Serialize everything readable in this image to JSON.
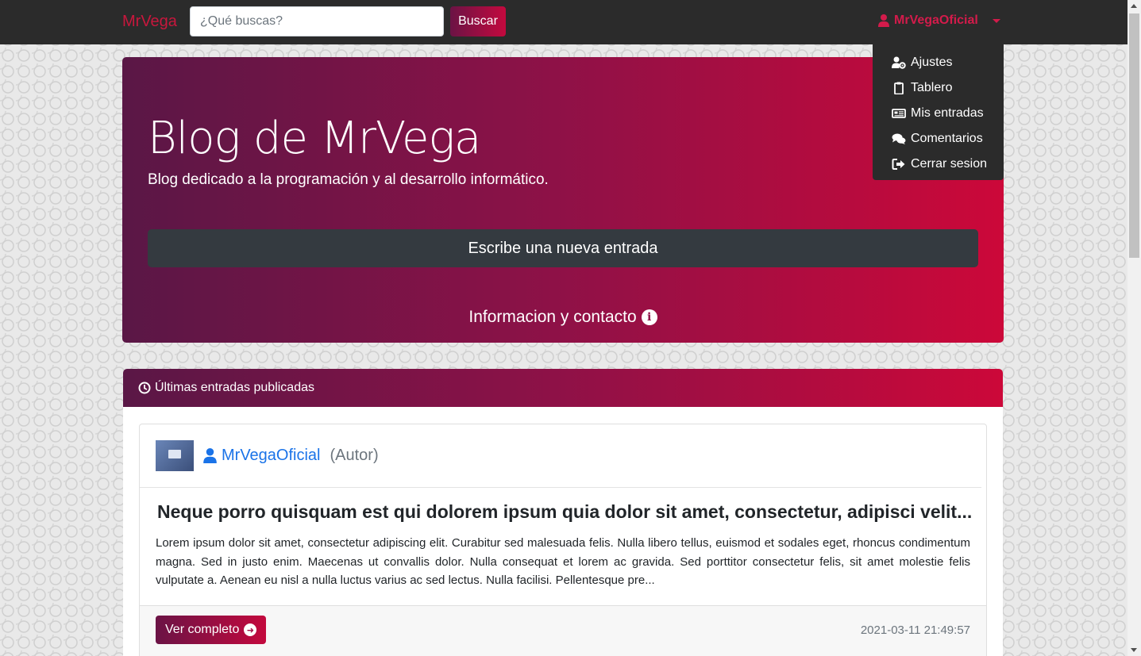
{
  "navbar": {
    "brand": "MrVega",
    "search_placeholder": "¿Qué buscas?",
    "search_button": "Buscar",
    "user": "MrVegaOficial"
  },
  "dropdown": {
    "items": [
      {
        "label": "Ajustes",
        "icon": "user-cog-icon"
      },
      {
        "label": "Tablero",
        "icon": "clipboard-icon"
      },
      {
        "label": "Mis entradas",
        "icon": "newspaper-icon"
      },
      {
        "label": "Comentarios",
        "icon": "comments-icon"
      },
      {
        "label": "Cerrar sesion",
        "icon": "sign-out-icon"
      }
    ]
  },
  "hero": {
    "title": "Blog de MrVega",
    "subtitle": "Blog dedicado a la programación y al desarrollo informático.",
    "new_entry_button": "Escribe una nueva entrada",
    "info_link": "Informacion y contacto"
  },
  "latest": {
    "header": "Últimas entradas publicadas",
    "post": {
      "author": "MrVegaOficial",
      "role": "(Autor)",
      "title": "Neque porro quisquam est qui dolorem ipsum quia dolor sit amet, consectetur, adipisci velit...",
      "body": "Lorem ipsum dolor sit amet, consectetur adipiscing elit. Curabitur sed malesuada felis. Nulla libero tellus, euismod et sodales eget, rhoncus condimentum magna. Sed in justo enim. Maecenas ut convallis dolor. Nulla consequat et lorem ac gravida. Sed porttitor consectetur felis, sit amet molestie felis vulputate a. Aenean eu nisl a nulla luctus varius ac sed lectus. Nulla facilisi. Pellentesque pre...",
      "more_button": "Ver completo",
      "date": "2021-03-11 21:49:57"
    }
  },
  "colors": {
    "accent": "#c8173d",
    "gradient_start": "#5a1746",
    "gradient_end": "#cc0839",
    "navbar": "#2b2b2b"
  }
}
